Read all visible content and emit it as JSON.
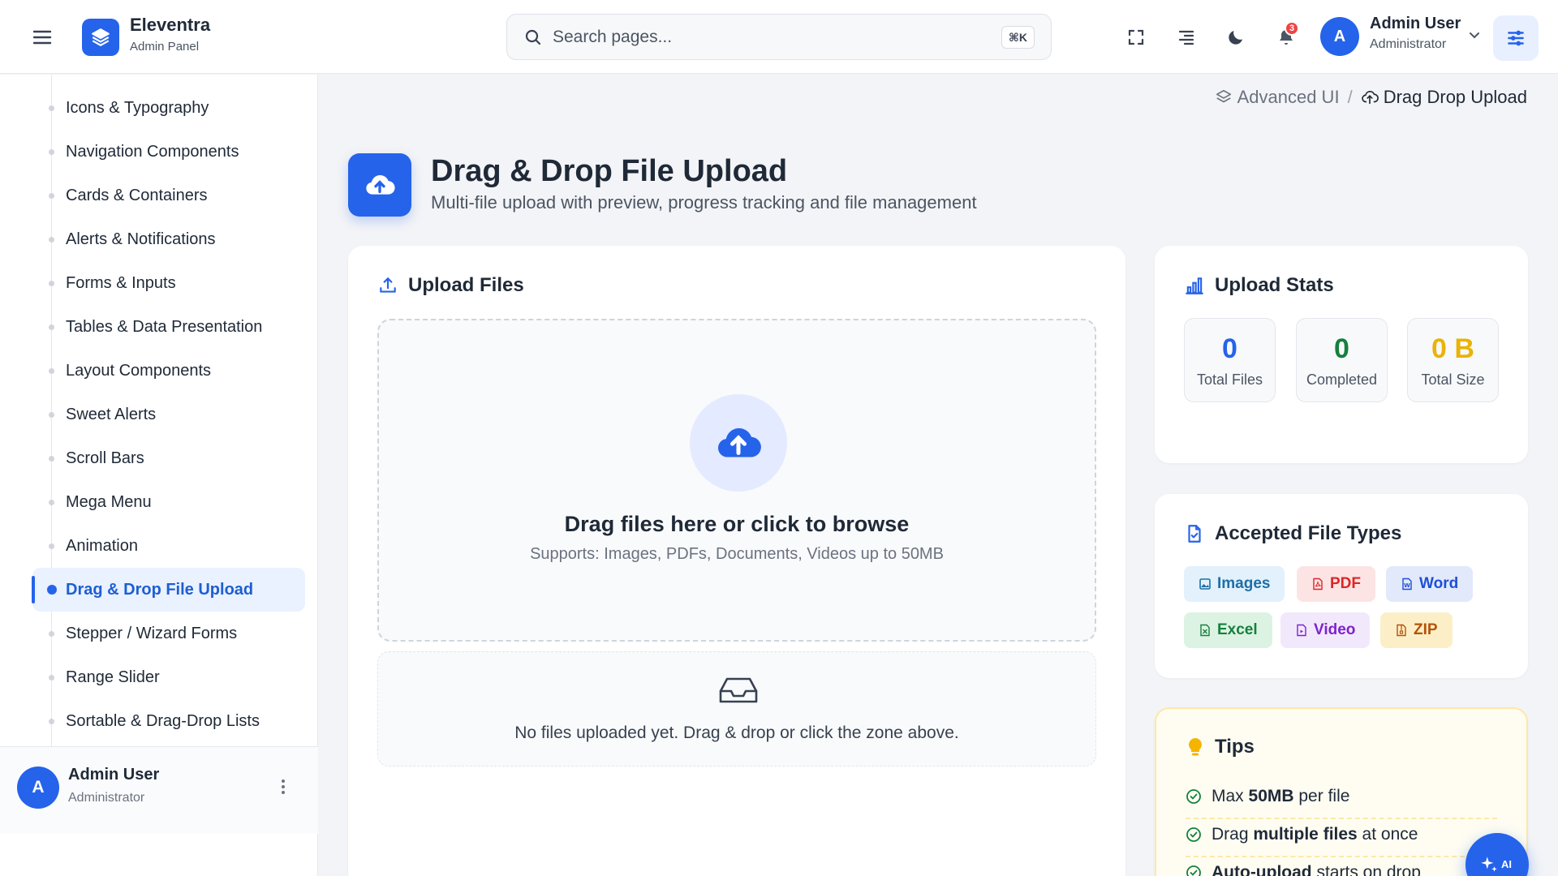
{
  "header": {
    "brand_name": "Eleventra",
    "brand_sub": "Admin Panel",
    "search_placeholder": "Search pages...",
    "search_shortcut": "⌘K",
    "notification_count": "3",
    "user_initial": "A",
    "user_name": "Admin User",
    "user_role": "Administrator"
  },
  "sidebar": {
    "items": [
      {
        "label": "Icons & Typography"
      },
      {
        "label": "Navigation Components"
      },
      {
        "label": "Cards & Containers"
      },
      {
        "label": "Alerts & Notifications"
      },
      {
        "label": "Forms & Inputs"
      },
      {
        "label": "Tables & Data Presentation"
      },
      {
        "label": "Layout Components"
      },
      {
        "label": "Sweet Alerts"
      },
      {
        "label": "Scroll Bars"
      },
      {
        "label": "Mega Menu"
      },
      {
        "label": "Animation"
      },
      {
        "label": "Drag & Drop File Upload"
      },
      {
        "label": "Stepper / Wizard Forms"
      },
      {
        "label": "Range Slider"
      },
      {
        "label": "Sortable & Drag-Drop Lists"
      }
    ],
    "active_index": 11,
    "footer": {
      "initial": "A",
      "name": "Admin User",
      "role": "Administrator"
    }
  },
  "breadcrumb": {
    "parent": "Advanced UI",
    "separator": "/",
    "current": "Drag Drop Upload"
  },
  "page": {
    "title": "Drag & Drop File Upload",
    "subtitle": "Multi-file upload with preview, progress tracking and file management"
  },
  "upload": {
    "card_title": "Upload Files",
    "dropzone_title": "Drag files here or click to browse",
    "dropzone_sub": "Supports: Images, PDFs, Documents, Videos up to 50MB",
    "empty_text": "No files uploaded yet. Drag & drop or click the zone above."
  },
  "stats": {
    "title": "Upload Stats",
    "total_files": {
      "value": "0",
      "label": "Total Files",
      "color": "#2563eb"
    },
    "completed": {
      "value": "0",
      "label": "Completed",
      "color": "#15803d"
    },
    "total_size": {
      "value": "0 B",
      "label": "Total Size",
      "color": "#eab308"
    }
  },
  "file_types": {
    "title": "Accepted File Types",
    "chips": [
      {
        "label": "Images",
        "icon": "image-icon",
        "color": "#1d6fa8",
        "bg": "#e2f1fb"
      },
      {
        "label": "PDF",
        "icon": "pdf-icon",
        "color": "#dc2626",
        "bg": "#fde4e4"
      },
      {
        "label": "Word",
        "icon": "word-icon",
        "color": "#1d4ed8",
        "bg": "#e1e9fb"
      },
      {
        "label": "Excel",
        "icon": "excel-icon",
        "color": "#15803d",
        "bg": "#dcf3e3"
      },
      {
        "label": "Video",
        "icon": "video-icon",
        "color": "#7e22ce",
        "bg": "#f2e8fb"
      },
      {
        "label": "ZIP",
        "icon": "zip-icon",
        "color": "#b45309",
        "bg": "#fcefc8"
      }
    ]
  },
  "tips": {
    "title": "Tips",
    "items": [
      {
        "pre": "Max ",
        "bold": "50MB",
        "post": " per file"
      },
      {
        "pre": "Drag ",
        "bold": "multiple files",
        "post": " at once"
      },
      {
        "pre": "",
        "bold": "Auto-upload",
        "post": " starts on drop"
      }
    ]
  },
  "ai_button": {
    "label": "AI"
  },
  "colors": {
    "accent": "#2563eb",
    "active_bg": "#eaf1ff",
    "tips_bg": "#fffdf2"
  }
}
